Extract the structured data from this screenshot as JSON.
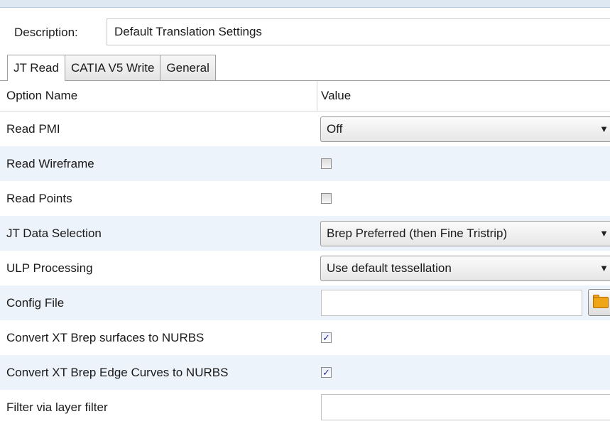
{
  "description": {
    "label": "Description:",
    "value": "Default Translation Settings"
  },
  "tabs": [
    {
      "label": "JT Read",
      "active": true
    },
    {
      "label": "CATIA V5 Write",
      "active": false
    },
    {
      "label": "General",
      "active": false
    }
  ],
  "grid": {
    "col_option": "Option Name",
    "col_value": "Value"
  },
  "options": [
    {
      "label": "Read PMI",
      "type": "select",
      "value": "Off"
    },
    {
      "label": "Read Wireframe",
      "type": "checkbox",
      "checked": false
    },
    {
      "label": "Read Points",
      "type": "checkbox",
      "checked": false
    },
    {
      "label": "JT Data Selection",
      "type": "select",
      "value": "Brep Preferred (then Fine Tristrip)"
    },
    {
      "label": "ULP Processing",
      "type": "select",
      "value": "Use default tessellation"
    },
    {
      "label": "Config File",
      "type": "file",
      "value": ""
    },
    {
      "label": "Convert XT Brep surfaces to NURBS",
      "type": "checkbox",
      "checked": true
    },
    {
      "label": "Convert XT Brep Edge Curves to NURBS",
      "type": "checkbox",
      "checked": true
    },
    {
      "label": "Filter via layer filter",
      "type": "text",
      "value": ""
    }
  ],
  "icons": {
    "dropdown": "chevron-down-icon",
    "browse": "folder-open-icon",
    "check": "checkmark-icon"
  },
  "colors": {
    "alt_row": "#edf3fa",
    "check": "#2a2f8f",
    "folder": "#f0a516"
  }
}
